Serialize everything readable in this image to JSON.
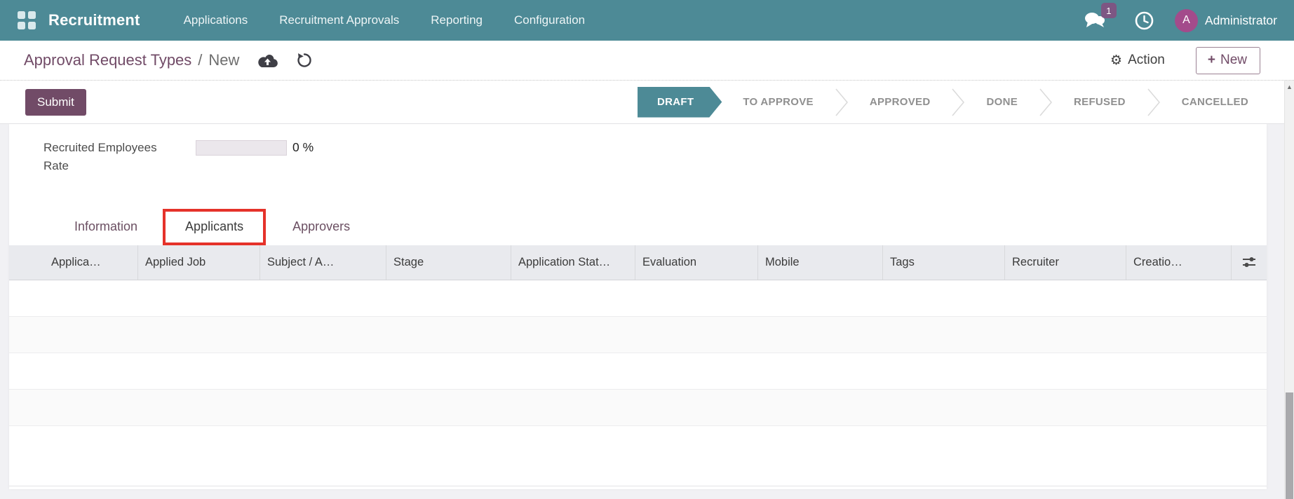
{
  "nav": {
    "app_name": "Recruitment",
    "menus": [
      "Applications",
      "Recruitment Approvals",
      "Reporting",
      "Configuration"
    ],
    "messages_badge": "1",
    "user": {
      "initial": "A",
      "name": "Administrator"
    }
  },
  "control_panel": {
    "breadcrumb": {
      "parent": "Approval Request Types",
      "separator": "/",
      "current": "New"
    },
    "action_label": "Action",
    "new_button": {
      "plus": "+",
      "label": "New"
    }
  },
  "statusbar": {
    "submit_label": "Submit",
    "stages": [
      {
        "label": "DRAFT",
        "active": true
      },
      {
        "label": "TO APPROVE",
        "active": false
      },
      {
        "label": "APPROVED",
        "active": false
      },
      {
        "label": "DONE",
        "active": false
      },
      {
        "label": "REFUSED",
        "active": false
      },
      {
        "label": "CANCELLED",
        "active": false
      }
    ]
  },
  "form": {
    "recruited_rate": {
      "label": "Recruited Employees Rate",
      "value": "0 %",
      "percent": 0
    }
  },
  "tabs": [
    {
      "label": "Information",
      "active": false,
      "highlighted": false
    },
    {
      "label": "Applicants",
      "active": true,
      "highlighted": true
    },
    {
      "label": "Approvers",
      "active": false,
      "highlighted": false
    }
  ],
  "applicants_table": {
    "columns": [
      "Applica…",
      "Applied Job",
      "Subject / A…",
      "Stage",
      "Application Stat…",
      "Evaluation",
      "Mobile",
      "Tags",
      "Recruiter",
      "Creatio…"
    ],
    "rows": []
  },
  "colors": {
    "nav_teal": "#4d8a96",
    "primary_purple": "#714b67",
    "active_stage_teal": "#4d8a96",
    "annotation_red": "#e5322a",
    "badge_purple": "#7d5683",
    "avatar_magenta": "#a34b8b",
    "table_header_bg": "#e9eaee",
    "row_stripe": "#fafafa"
  }
}
